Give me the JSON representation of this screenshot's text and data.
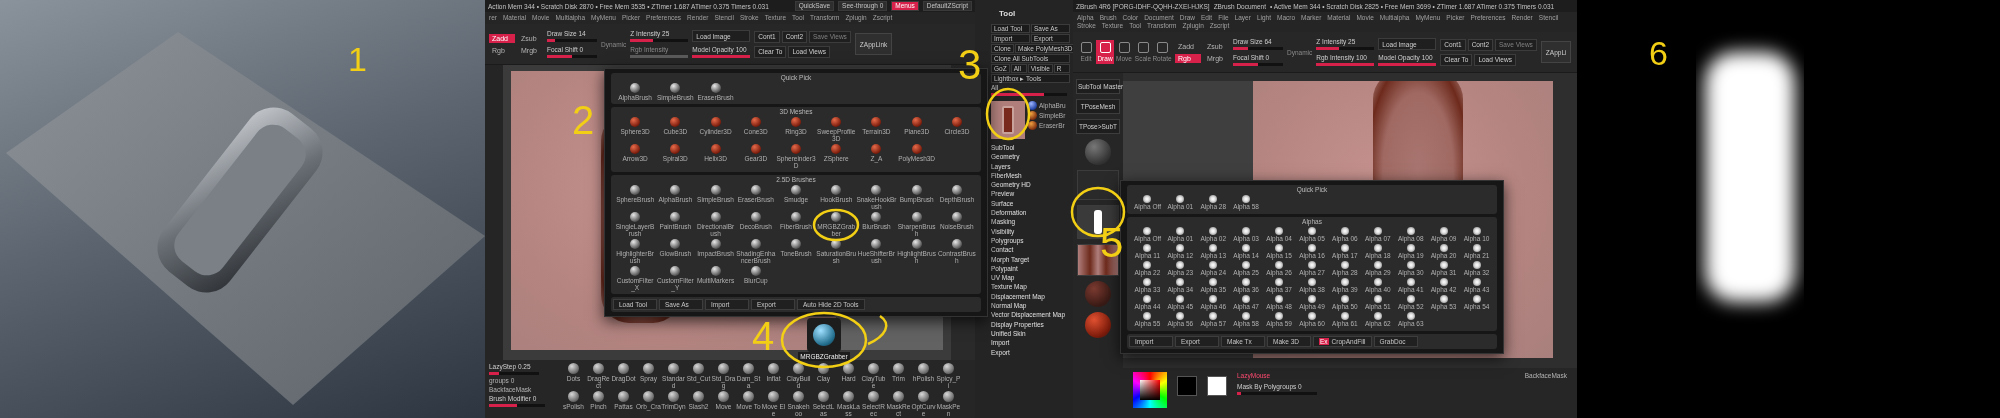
{
  "render_panel": {
    "number": "1"
  },
  "zbrush_left": {
    "number": "2",
    "status": "Action Mem 344 • Scratch Disk 2870 • Free Mem 3535 • ZTimer 1.687 ATimer 0.375 Timers 0.031",
    "header_buttons": [
      {
        "label": "QuickSave",
        "selected": false
      },
      {
        "label": "See-through 0",
        "selected": false
      },
      {
        "label": "Menus",
        "selected": true
      },
      {
        "label": "DefaultZScript",
        "selected": false
      }
    ],
    "menu": [
      "rer",
      "Material",
      "Movie",
      "Multialpha",
      "MyMenu",
      "Picker",
      "Preferences",
      "Render",
      "Stencil",
      "Stroke",
      "Texture",
      "Tool",
      "Transform",
      "Zplugin",
      "Zscript"
    ],
    "toolbar": {
      "modes": [
        {
          "label": "Zadd",
          "selected": true
        },
        {
          "label": "Zsub",
          "selected": false
        },
        {
          "label": "Rgb",
          "selected": false
        },
        {
          "label": "Mrgb",
          "selected": false
        }
      ],
      "sliders": [
        {
          "label": "Draw Size 14",
          "level": 0.15,
          "disabled": false
        },
        {
          "label": "Focal Shift 0",
          "level": 0.5,
          "disabled": false
        },
        {
          "label": "Z Intensity 25",
          "level": 0.4,
          "disabled": false
        },
        {
          "label": "Rgb Intensity",
          "level": 1,
          "disabled": true
        }
      ],
      "dynamic": "Dynamic",
      "load_image": "Load Image",
      "model_opacity": {
        "label": "Model Opacity 100",
        "level": 1
      },
      "view_buttons": [
        {
          "label": "Cont1",
          "disabled": false
        },
        {
          "label": "Cont2",
          "disabled": false
        },
        {
          "label": "Save Views",
          "disabled": true
        },
        {
          "label": "Clear To",
          "disabled": false
        },
        {
          "label": "Load Views",
          "disabled": false
        }
      ],
      "zapplink": "ZAppLink"
    },
    "bottom": {
      "lazy_step": {
        "label": "LazyStep 0.25",
        "level": 0.2
      },
      "groups": "groups 0",
      "backface": "BackfaceMask",
      "modifier": {
        "label": "Brush Modifier 0",
        "level": 0.5
      },
      "brushes": [
        "Dots",
        "DragRect",
        "DragDot",
        "Spray",
        "Standard",
        "Std_Cut",
        "Std_Drag",
        "Dam_Sta",
        "Inflat",
        "ClayBuild",
        "Clay",
        "Hard",
        "ClayTube",
        "Trim",
        "hPolish",
        "Spicy_Pi",
        "sPolish",
        "Pinch",
        "Pattas",
        "Orb_Cra",
        "TrimDyn",
        "Slash2",
        "Move",
        "Move To",
        "Move Ele",
        "Snakehoo",
        "SelectLas",
        "MaskLass",
        "SelectRec",
        "MaskRect",
        "OptCurve",
        "MaskPen"
      ]
    }
  },
  "brush_popup": {
    "sections": [
      {
        "title": "Quick Pick",
        "kind": "brush",
        "items": [
          "AlphaBrush",
          "SimpleBrush",
          "EraserBrush"
        ]
      },
      {
        "title": "3D Meshes",
        "kind": "mesh",
        "items": [
          "Sphere3D",
          "Cube3D",
          "Cylinder3D",
          "Cone3D",
          "Ring3D",
          "SweepProfile3D",
          "Terrain3D",
          "Plane3D",
          "Circle3D",
          "Arrow3D",
          "Spiral3D",
          "Helix3D",
          "Gear3D",
          "Sphereinder3D",
          "ZSphere",
          "Z_A",
          "PolyMesh3D"
        ]
      },
      {
        "title": "2.5D Brushes",
        "kind": "brush",
        "items": [
          "SphereBrush",
          "AlphaBrush",
          "SimpleBrush",
          "EraserBrush",
          "Smudge",
          "HookBrush",
          "SnakeHookBrush",
          "BumpBrush",
          "DepthBrush",
          "SingleLayerBrush",
          "PaintBrush",
          "DirectionalBrush",
          "DecoBrush",
          "FiberBrush",
          "MRGBZGrabber",
          "BlurBrush",
          "SharpenBrush",
          "NoiseBrush",
          "HighlighterBrush",
          "GlowBrush",
          "ImpactBrush",
          "ShadingEnhancerBrush",
          "ToneBrush",
          "SaturationBrush",
          "HueShifterBrush",
          "HighlightBrush",
          "ContrastBrush",
          "CustomFilter_X",
          "CustomFilter_Y",
          "MultiMarkers",
          "BlurCup"
        ]
      }
    ],
    "footer": [
      "Load Tool",
      "Save As",
      "Import",
      "Export",
      "Auto Hide 2D Tools"
    ]
  },
  "grabber": {
    "number": "4",
    "label": "MRGBZGrabber"
  },
  "tool_panel": {
    "number": "3",
    "title": "Tool",
    "button_rows": [
      [
        "Load Tool",
        "Save As"
      ],
      [
        "Import",
        "Export"
      ],
      [
        "Clone",
        "Make PolyMesh3D"
      ],
      [
        "Clone All SubTools"
      ],
      [
        "GoZ",
        "All",
        "Visible",
        "R"
      ],
      [
        "Lightbox ▸ Tools"
      ]
    ],
    "all_slider": {
      "label": "All",
      "level": 0.7
    },
    "thumbnails": [
      "AlphaBru",
      "SimpleBr",
      "EraserBr"
    ],
    "items": [
      "SubTool",
      "Geometry",
      "Layers",
      "FiberMesh",
      "Geometry HD",
      "Preview",
      "Surface",
      "Deformation",
      "Masking",
      "Visibility",
      "Polygroups",
      "Contact",
      "Morph Target",
      "Polypaint",
      "UV Map",
      "Texture Map",
      "Displacement Map",
      "Normal Map",
      "Vector Displacement Map",
      "Display Properties",
      "Unified Skin",
      "Import",
      "Export"
    ]
  },
  "zbrush_right": {
    "number": "5",
    "title": "ZBrush 4R6 [PORG-IDHF-QQHH-ZXEI-HJKS]",
    "document": "ZBrush Document",
    "stats": "• Active Mem 344 • Scratch Disk 2825 • Free Mem 3699 • ZTimer 1.687 ATimer 0.375 Timers 0.031",
    "menu": [
      "Alpha",
      "Brush",
      "Color",
      "Document",
      "Draw",
      "Edit",
      "File",
      "Layer",
      "Light",
      "Macro",
      "Marker",
      "Material",
      "Movie",
      "Multialpha",
      "MyMenu",
      "Picker",
      "Preferences",
      "Render",
      "Stencil",
      "Stroke",
      "Texture",
      "Tool",
      "Transform",
      "Zplugin",
      "Zscript"
    ],
    "toolbar": {
      "transform": [
        {
          "label": "Edit",
          "selected": false
        },
        {
          "label": "Draw",
          "selected": true
        },
        {
          "label": "Move",
          "selected": false
        },
        {
          "label": "Scale",
          "selected": false
        },
        {
          "label": "Rotate",
          "selected": false
        }
      ],
      "modes": [
        {
          "label": "Zadd",
          "selected": false
        },
        {
          "label": "Zsub",
          "selected": false
        },
        {
          "label": "Rgb",
          "selected": true
        },
        {
          "label": "Mrgb",
          "selected": false
        }
      ],
      "sliders": [
        {
          "label": "Draw Size 64",
          "level": 0.3,
          "disabled": false
        },
        {
          "label": "Focal Shift 0",
          "level": 0.5,
          "disabled": false
        },
        {
          "label": "Z Intensity 25",
          "level": 0.4,
          "disabled": false
        },
        {
          "label": "Rgb Intensity 100",
          "level": 1,
          "disabled": false
        }
      ],
      "dynamic": "Dynamic",
      "load_image": "Load Image",
      "model_opacity": {
        "label": "Model Opacity 100",
        "level": 1
      },
      "view_buttons": [
        {
          "label": "Cont1",
          "disabled": false
        },
        {
          "label": "Cont2",
          "disabled": false
        },
        {
          "label": "Save Views",
          "disabled": true
        },
        {
          "label": "Clear To",
          "disabled": false
        },
        {
          "label": "Load Views",
          "disabled": false
        }
      ],
      "zapplink": "ZAppLi"
    },
    "shelf": [
      "SubTool Master",
      "TPoseMesh",
      "TPose>SubT"
    ],
    "bottom": {
      "lazy": "LazyMouse",
      "mask": {
        "label": "Mask By Polygroups 0",
        "level": 0.05
      },
      "backface": "BackfaceMask"
    }
  },
  "alpha_popup": {
    "quick_pick": {
      "title": "Quick Pick",
      "items": [
        "Alpha Off",
        "Alpha 01",
        "Alpha 28",
        "Alpha 58"
      ]
    },
    "alphas": {
      "title": "Alphas",
      "items": [
        "Alpha Off",
        "Alpha 01",
        "Alpha 02",
        "Alpha 03",
        "Alpha 04",
        "Alpha 05",
        "Alpha 06",
        "Alpha 07",
        "Alpha 08",
        "Alpha 09",
        "Alpha 10",
        "Alpha 11",
        "Alpha 12",
        "Alpha 13",
        "Alpha 14",
        "Alpha 15",
        "Alpha 16",
        "Alpha 17",
        "Alpha 18",
        "Alpha 19",
        "Alpha 20",
        "Alpha 21",
        "Alpha 22",
        "Alpha 23",
        "Alpha 24",
        "Alpha 25",
        "Alpha 26",
        "Alpha 27",
        "Alpha 28",
        "Alpha 29",
        "Alpha 30",
        "Alpha 31",
        "Alpha 32",
        "Alpha 33",
        "Alpha 34",
        "Alpha 35",
        "Alpha 36",
        "Alpha 37",
        "Alpha 38",
        "Alpha 39",
        "Alpha 40",
        "Alpha 41",
        "Alpha 42",
        "Alpha 43",
        "Alpha 44",
        "Alpha 45",
        "Alpha 46",
        "Alpha 47",
        "Alpha 48",
        "Alpha 49",
        "Alpha 50",
        "Alpha 51",
        "Alpha 52",
        "Alpha 53",
        "Alpha 54",
        "Alpha 55",
        "Alpha 56",
        "Alpha 57",
        "Alpha 58",
        "Alpha 59",
        "Alpha 60",
        "Alpha 61",
        "Alpha 62",
        "Alpha 63"
      ]
    },
    "footer": [
      {
        "label": "Import"
      },
      {
        "label": "Export"
      },
      {
        "label": "Make Tx"
      },
      {
        "label": "Make 3D"
      },
      {
        "label": "CropAndFill",
        "badge": "Ex"
      },
      {
        "label": "GrabDoc"
      }
    ]
  },
  "alpha_panel": {
    "number": "6"
  }
}
